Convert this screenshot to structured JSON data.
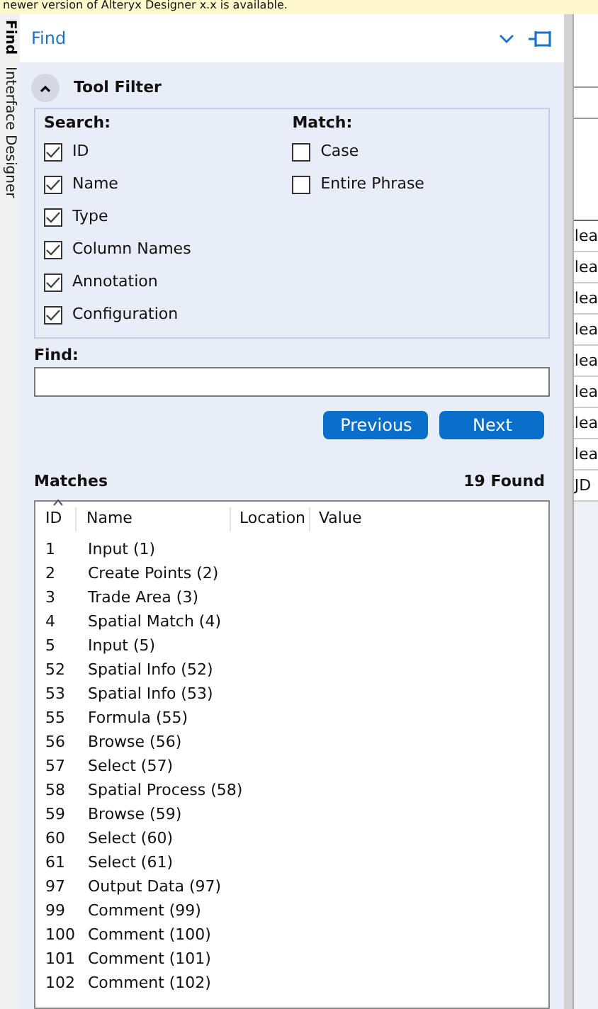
{
  "banner": {
    "text": "newer version of Alteryx Designer x.x is available."
  },
  "side_tabs": [
    {
      "label": "Find",
      "selected": true
    },
    {
      "label": "Interface Designer",
      "selected": false
    }
  ],
  "panel": {
    "title": "Find"
  },
  "tool_filter": {
    "title": "Tool Filter",
    "expanded": true,
    "search": {
      "label": "Search:",
      "options": [
        {
          "label": "ID",
          "checked": true
        },
        {
          "label": "Name",
          "checked": true
        },
        {
          "label": "Type",
          "checked": true
        },
        {
          "label": "Column Names",
          "checked": true
        },
        {
          "label": "Annotation",
          "checked": true
        },
        {
          "label": "Configuration",
          "checked": true
        }
      ]
    },
    "match": {
      "label": "Match:",
      "options": [
        {
          "label": "Case",
          "checked": false
        },
        {
          "label": "Entire Phrase",
          "checked": false
        }
      ]
    }
  },
  "find": {
    "label": "Find:"
  },
  "buttons": [
    "Previous",
    "Next"
  ],
  "matches": {
    "title": "Matches",
    "count": "19 Found",
    "columns": [
      "ID",
      "Name",
      "Location",
      "Value"
    ],
    "rows": [
      {
        "id": "1",
        "name": "Input (1)"
      },
      {
        "id": "2",
        "name": "Create Points (2)"
      },
      {
        "id": "3",
        "name": "Trade Area (3)"
      },
      {
        "id": "4",
        "name": "Spatial Match (4)"
      },
      {
        "id": "5",
        "name": "Input (5)"
      },
      {
        "id": "52",
        "name": "Spatial Info (52)"
      },
      {
        "id": "53",
        "name": "Spatial Info (53)"
      },
      {
        "id": "55",
        "name": "Formula (55)"
      },
      {
        "id": "56",
        "name": "Browse (56)"
      },
      {
        "id": "57",
        "name": "Select (57)"
      },
      {
        "id": "58",
        "name": "Spatial Process (58)"
      },
      {
        "id": "59",
        "name": "Browse (59)"
      },
      {
        "id": "60",
        "name": "Select (60)"
      },
      {
        "id": "61",
        "name": "Select (61)"
      },
      {
        "id": "97",
        "name": "Output Data (97)"
      },
      {
        "id": "99",
        "name": "Comment (99)"
      },
      {
        "id": "100",
        "name": "Comment (100)"
      },
      {
        "id": "101",
        "name": "Comment (101)"
      },
      {
        "id": "102",
        "name": "Comment (102)"
      }
    ]
  },
  "background_grid": {
    "cells": [
      "lea",
      "lea",
      "lea",
      "lea",
      "lea",
      "lea",
      "lea",
      "lea",
      "JD"
    ]
  }
}
